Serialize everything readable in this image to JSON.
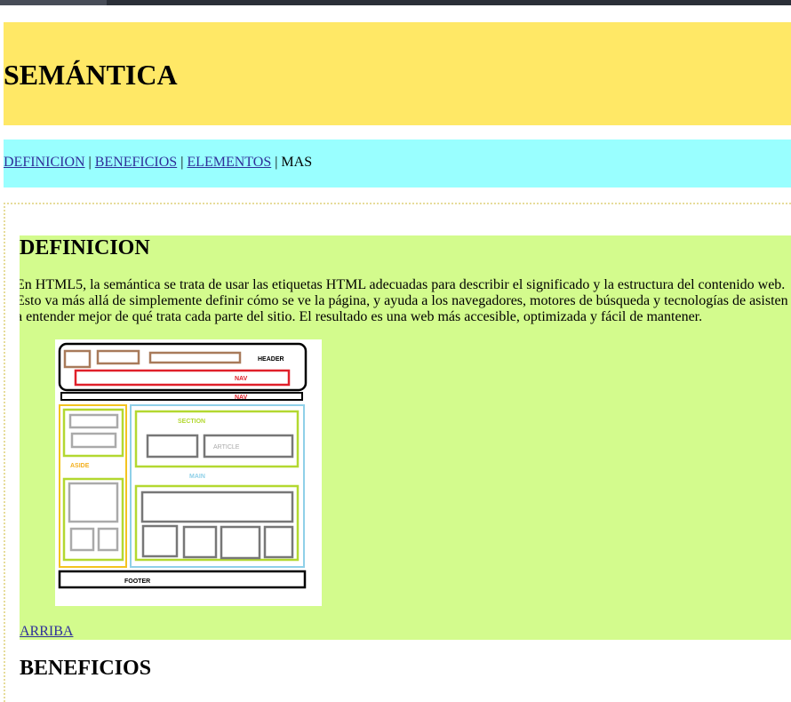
{
  "header": {
    "title": "SEMÁNTICA"
  },
  "nav": {
    "links": [
      "DEFINICION",
      "BENEFICIOS",
      "ELEMENTOS"
    ],
    "separator": " | ",
    "last": "MAS"
  },
  "section": {
    "heading": "DEFINICION",
    "paragraph_lines": [
      "En HTML5, la semántica se trata de usar las etiquetas HTML adecuadas para describir el significado y la estructura del contenido web.",
      "Esto va más allá de simplemente definir cómo se ve la página, y ayuda a los navegadores, motores de búsqueda y tecnologías de asisten",
      "a entender mejor de qué trata cada parte del sitio. El resultado es una web más accesible, optimizada y fácil de mantener."
    ],
    "diagram_labels": {
      "header": "HEADER",
      "nav1": "NAV",
      "nav2": "NAV",
      "section": "SECTION",
      "article": "ARTICLE",
      "aside": "ASIDE",
      "main": "MAIN",
      "footer": "FOOTER"
    },
    "back_link": "ARRIBA"
  },
  "next_section": {
    "heading": "BENEFICIOS"
  },
  "colors": {
    "header_bg": "#ffe866",
    "nav_bg": "#99ffff",
    "section_bg": "#d3fb8d",
    "link": "#2f2f9a"
  }
}
